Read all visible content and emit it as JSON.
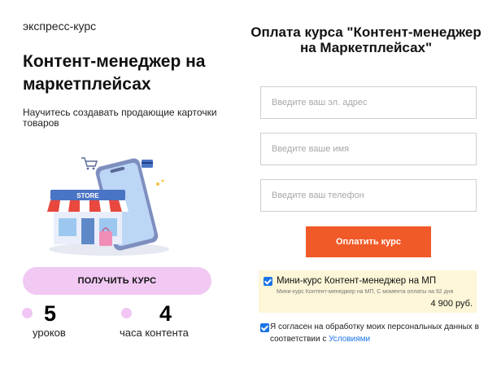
{
  "promo": {
    "badge": "экспресс-курс",
    "title": "Контент-менеджер на маркетплейсах",
    "subtitle": "Научитесь создавать продающие карточки товаров",
    "illustration_store_sign": "STORE",
    "cta_label": "ПОЛУЧИТЬ КУРС",
    "stats": [
      {
        "number": "5",
        "label": "уроков"
      },
      {
        "number": "4",
        "label": "часа контента"
      }
    ]
  },
  "payment": {
    "title": "Оплата курса \"Контент-менеджер на Маркетплейсах\"",
    "email_placeholder": "Введите ваш эл. адрес",
    "name_placeholder": "Введите ваше имя",
    "phone_placeholder": "Введите ваш телефон",
    "pay_button_label": "Оплатить курс",
    "product": {
      "name": "Мини-курс Контент-менеджер на МП",
      "description": "Мини-курс Контент-менеджер на МП, С момента оплаты на 92 дня",
      "price": "4 900 руб.",
      "checked": true
    },
    "consent": {
      "text": "Я согласен на обработку моих персональных данных в соответствии с ",
      "link_text": "Условиями",
      "checked": true
    }
  },
  "colors": {
    "accent_pink": "#f1c9f3",
    "pay_orange": "#f05a28",
    "product_bg": "#fdf6d8",
    "checkbox_blue": "#1a73e8"
  },
  "icons": [
    "shopping-cart-icon",
    "credit-card-icon",
    "store-illustration",
    "smartphone-illustration",
    "shopping-bag-icon",
    "checkbox-checked-icon"
  ]
}
